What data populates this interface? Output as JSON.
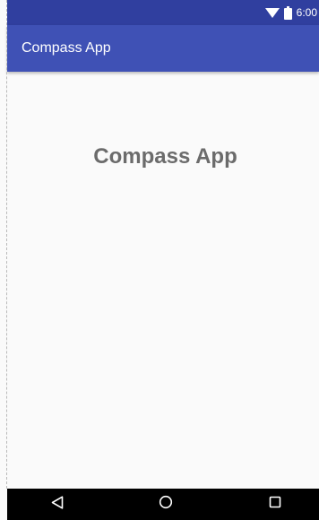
{
  "status_bar": {
    "time": "6:00",
    "icons": [
      "wifi-icon",
      "battery-icon"
    ]
  },
  "app_bar": {
    "title": "Compass App"
  },
  "main": {
    "heading": "Compass App"
  },
  "nav_bar": {
    "buttons": [
      "back-icon",
      "home-icon",
      "recents-icon"
    ]
  },
  "colors": {
    "status_bar": "#303f9f",
    "app_bar": "#3f51b5",
    "background": "#fafafa",
    "heading_text": "#6b6b6b",
    "nav_bar": "#000000"
  }
}
